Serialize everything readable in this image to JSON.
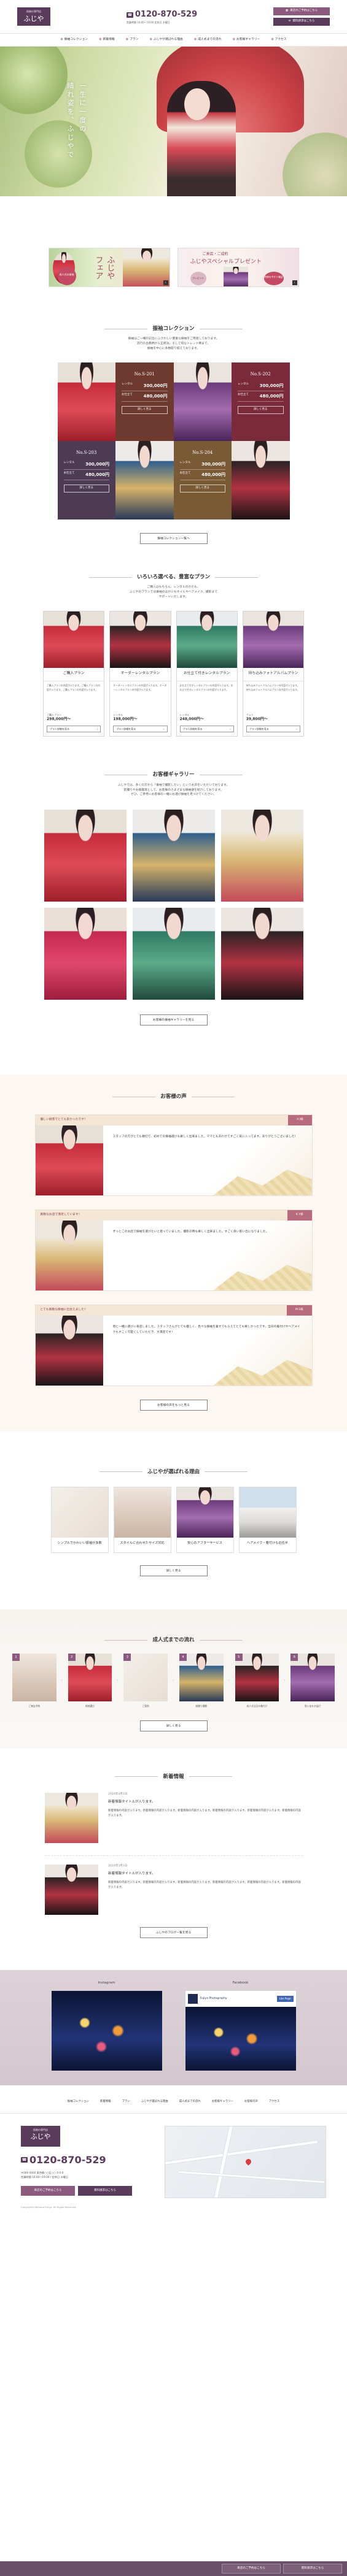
{
  "header": {
    "logo_sub": "振袖の専門店",
    "logo_main": "ふじや",
    "tel": "0120-870-529",
    "hours": "営業時間 10:00〜19:00 定休日 水曜日",
    "btn_reserve": "来店のご予約はこちら",
    "btn_contact": "資料請求はこちら"
  },
  "nav": [
    "振袖コレクション",
    "新着情報",
    "プラン",
    "ふじやが選ばれる理由",
    "成人式までの流れ",
    "お客様ギャラリー",
    "アクセス"
  ],
  "hero": {
    "line1": "一生に一度の",
    "line2": "晴れ姿を、ふじやで"
  },
  "banners": {
    "b1_title": "ふじやフェア",
    "b1_sub": "成人式の振袖",
    "b2_title": "ご来店・ご成約",
    "b2_sub": "ふじやスペシャルプレゼント",
    "b2_note": "特典を今すぐ確認",
    "b2_gift": "プレゼント"
  },
  "collection": {
    "title": "振袖コレクション",
    "sub": "振袖はご一緒の記念にふさわしい豊富な振袖をご用意しております。\n流行の古典柄から正統派、そして旬なトレンド柄まで、\n振袖を中心に多数取り揃えております。",
    "items": [
      {
        "no": "No.S-201",
        "r1": "レンタル",
        "p1": "300,000円",
        "r2": "お仕立て",
        "p2": "480,000円",
        "btn": "詳しく見る"
      },
      {
        "no": "No.S-202",
        "r1": "レンタル",
        "p1": "300,000円",
        "r2": "お仕立て",
        "p2": "480,000円",
        "btn": "詳しく見る"
      },
      {
        "no": "No.S-203",
        "r1": "レンタル",
        "p1": "300,000円",
        "r2": "お仕立て",
        "p2": "480,000円",
        "btn": "詳しく見る"
      },
      {
        "no": "No.S-204",
        "r1": "レンタル",
        "p1": "300,000円",
        "r2": "お仕立て",
        "p2": "480,000円",
        "btn": "詳しく見る"
      }
    ],
    "more": "振袖コレクション一覧へ"
  },
  "plans": {
    "title": "いろいろ選べる、豊富なプラン",
    "sub": "ご購入はもちろん、レンタルのかたも、\nふじやのプランでは振袖のほかにもネイルやヘアメイク、撮影まで\nサポートいたします。",
    "items": [
      {
        "name": "ご購入プラン",
        "desc": "ご購入プランの内容が入ります。ご購入プランの内容が入ります。ご購入プランの内容が入ります。",
        "label": "ご購入プラン",
        "price": "298,000円〜",
        "btn": "プラン詳細を見る"
      },
      {
        "name": "オーダーレンタルプラン",
        "desc": "オーダーレンタルプランの内容が入ります。オーダーレンタルプランの内容が入ります。",
        "label": "レンタル",
        "price": "198,000円〜",
        "btn": "プラン詳細を見る"
      },
      {
        "name": "お仕立て付きレンタルプラン",
        "desc": "お仕立て付きレンタルプランの内容が入ります。お仕立て付きレンタルプランの内容が入ります。",
        "label": "レンタル",
        "price": "248,000円〜",
        "btn": "プラン詳細を見る"
      },
      {
        "name": "持ち込みフォトアルバムプラン",
        "desc": "持ち込みフォトアルバムプランの内容が入ります。持ち込みフォトアルバムプランの内容が入ります。",
        "label": "フォト",
        "price": "39,800円〜",
        "btn": "プラン詳細を見る"
      }
    ]
  },
  "gallery": {
    "title": "お客様ギャラリー",
    "sub": "ふじやでは、多くの方から「振袖で撮影したい」というお声をいただいております。\n前撮りやお披露目として、お客様のさまざまな振袖姿を紹介しております。\nぜひ、ご参考にお客様の一緒にお選び振袖を見つけてください。",
    "more": "お客様の振袖ギャラリーを見る"
  },
  "voices": {
    "title": "お客様の声",
    "items": [
      {
        "head": "優しい接客でとても良かったです！",
        "tag": "A.I様",
        "body": "スタッフの方がとても親切で、初めての振袖選びも楽しく出来ました。ママともあわせてすごく気に入ってます。ありがとうございました！"
      },
      {
        "head": "素敵なお店で満足しています！",
        "tag": "K.Y様",
        "body": "ずっとこのお店で振袖を選びたいと思っていました。撮影の時も楽しく出来ました。すごく良い思い出になりました。"
      },
      {
        "head": "とても素敵な振袖に出会えました！",
        "tag": "M.S様",
        "body": "母と一緒に選びに来店しました。スタッフさんがとても優しく、色々な振袖を着せてもらえてとても楽しかったです。当日の着付けやヘアメイクもすごく可愛くしていただき、大満足です！"
      }
    ],
    "more": "お客様の声をもっと見る"
  },
  "reasons": {
    "title": "ふじやが選ばれる理由",
    "items": [
      "シンプルでかわいい振袖が多数",
      "スタイルに合わせたサイズ対応",
      "安心のアフターサービス",
      "ヘアメイク・着付けもお任せ"
    ],
    "more": "詳しく見る"
  },
  "flow": {
    "title": "成人式までの流れ",
    "steps": [
      "ご来店予約",
      "振袖選び",
      "ご契約",
      "前撮り撮影",
      "成人式当日の着付け",
      "思い出をお届け"
    ],
    "more": "詳しく見る"
  },
  "news": {
    "title": "新着情報",
    "items": [
      {
        "date": "2019年4月1日",
        "title": "新着情報タイトルが入ります。",
        "body": "新着情報の内容が入ります。新着情報の内容が入ります。新着情報の内容が入ります。新着情報の内容が入ります。新着情報の内容が入ります。新着情報の内容が入ります。"
      },
      {
        "date": "2019年3月1日",
        "title": "新着情報タイトルが入ります。",
        "body": "新着情報の内容が入ります。新着情報の内容が入ります。新着情報の内容が入ります。新着情報の内容が入ります。新着情報の内容が入ります。新着情報の内容が入ります。"
      }
    ],
    "more": "ふじやのブログ一覧を見る"
  },
  "sns": {
    "instagram": "Instagram",
    "facebook": "Facebook",
    "fb_page": "Fujiya Photography",
    "fb_like": "Like Page"
  },
  "footer": {
    "nav": [
      "振袖コレクション",
      "新着情報",
      "プラン",
      "ふじやが選ばれる理由",
      "成人式までの流れ",
      "お客様ギャラリー",
      "お客様の声",
      "アクセス"
    ],
    "logo_sub": "振袖の専門店",
    "logo_main": "ふじや",
    "tel": "0120-870-529",
    "addr": "〒000-0000 東京都○○区○○ 0-0-0\n営業時間 10:00〜19:00 / 定休日 水曜日",
    "btn_reserve": "来店のご予約はこちら",
    "btn_contact": "資料請求はこちら",
    "copy": "Copyright(c)Kimono Fujiya. All Rights Reserved.",
    "fix_reserve": "来店のご予約はこちら",
    "fix_contact": "資料請求はこちら"
  },
  "colors": {
    "brand": "#5a3b5c",
    "accent": "#8b5a7e",
    "voice_tag": "#b86b7c"
  }
}
